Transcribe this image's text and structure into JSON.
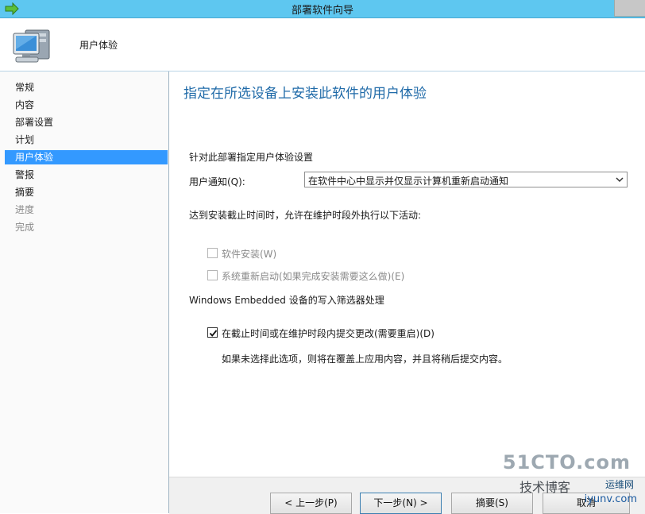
{
  "window": {
    "title": "部署软件向导",
    "icon": "wizard-arrow-icon"
  },
  "header": {
    "title": "用户体验",
    "icon": "computer-icon"
  },
  "sidebar": {
    "items": [
      {
        "label": "常规",
        "state": "normal"
      },
      {
        "label": "内容",
        "state": "normal"
      },
      {
        "label": "部署设置",
        "state": "normal"
      },
      {
        "label": "计划",
        "state": "normal"
      },
      {
        "label": "用户体验",
        "state": "active"
      },
      {
        "label": "警报",
        "state": "normal"
      },
      {
        "label": "摘要",
        "state": "normal"
      },
      {
        "label": "进度",
        "state": "disabled"
      },
      {
        "label": "完成",
        "state": "disabled"
      }
    ]
  },
  "main": {
    "heading": "指定在所选设备上安装此软件的用户体验",
    "section_label": "针对此部署指定用户体验设置",
    "user_notification": {
      "label": "用户通知(Q):",
      "value": "在软件中心中显示并仅显示计算机重新启动通知"
    },
    "deadline_label": "达到安装截止时间时，允许在维护时段外执行以下活动:",
    "checkbox_install": {
      "label": "软件安装(W)",
      "checked": false,
      "enabled": false
    },
    "checkbox_restart": {
      "label": "系统重新启动(如果完成安装需要这么做)(E)",
      "checked": false,
      "enabled": false
    },
    "embedded_label": "Windows Embedded 设备的写入筛选器处理",
    "checkbox_commit": {
      "label": "在截止时间或在维护时段内提交更改(需要重启)(D)",
      "checked": true,
      "enabled": true
    },
    "commit_note": "如果未选择此选项，则将在覆盖上应用内容，并且将稍后提交内容。"
  },
  "footer": {
    "prev": "< 上一步(P)",
    "next": "下一步(N) >",
    "summary": "摘要(S)",
    "cancel": "取消"
  },
  "watermark": {
    "line1": "51CTO.com",
    "line2": "技术博客",
    "line3": "运维网",
    "line4": "iyunv.com"
  }
}
